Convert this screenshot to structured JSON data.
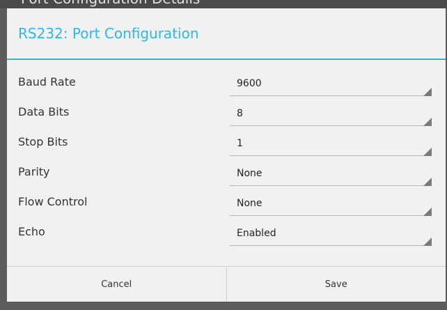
{
  "background": {
    "title": "Port Configuration Details"
  },
  "dialog": {
    "title": "RS232: Port Configuration",
    "accent_color": "#33b5e5",
    "fields": [
      {
        "label": "Baud Rate",
        "value": "9600"
      },
      {
        "label": "Data Bits",
        "value": "8"
      },
      {
        "label": "Stop Bits",
        "value": "1"
      },
      {
        "label": "Parity",
        "value": "None"
      },
      {
        "label": "Flow Control",
        "value": "None"
      },
      {
        "label": "Echo",
        "value": "Enabled"
      }
    ],
    "cancel_label": "Cancel",
    "save_label": "Save"
  }
}
